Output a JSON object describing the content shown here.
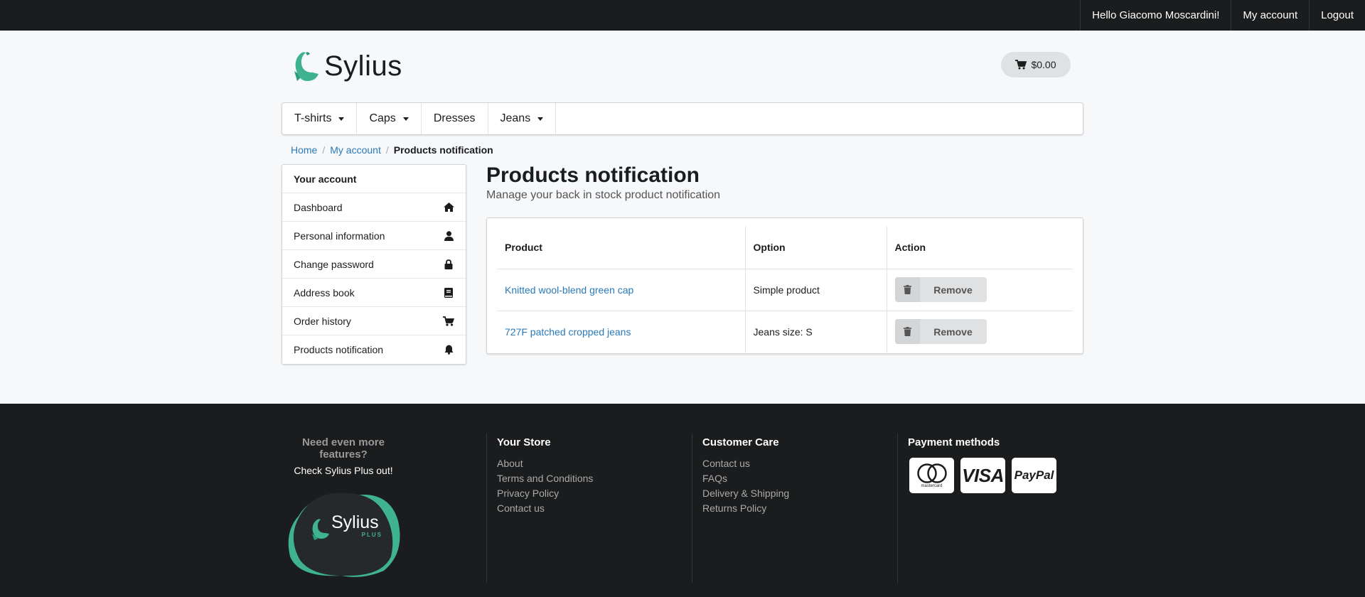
{
  "topbar": {
    "greeting": "Hello Giacomo Moscardini!",
    "account": "My account",
    "logout": "Logout"
  },
  "header": {
    "logo_text": "Sylius",
    "cart_total": "$0.00"
  },
  "menu": {
    "items": [
      {
        "label": "T-shirts",
        "dropdown": true
      },
      {
        "label": "Caps",
        "dropdown": true
      },
      {
        "label": "Dresses",
        "dropdown": false
      },
      {
        "label": "Jeans",
        "dropdown": true
      }
    ]
  },
  "breadcrumb": {
    "home": "Home",
    "account": "My account",
    "current": "Products notification"
  },
  "sidebar": {
    "title": "Your account",
    "items": [
      {
        "label": "Dashboard",
        "icon": "home-icon"
      },
      {
        "label": "Personal information",
        "icon": "user-icon"
      },
      {
        "label": "Change password",
        "icon": "lock-icon"
      },
      {
        "label": "Address book",
        "icon": "book-icon"
      },
      {
        "label": "Order history",
        "icon": "cart-icon"
      },
      {
        "label": "Products notification",
        "icon": "bell-icon"
      }
    ]
  },
  "main": {
    "title": "Products notification",
    "subtitle": "Manage your back in stock product notification",
    "table": {
      "headers": [
        "Product",
        "Option",
        "Action"
      ],
      "rows": [
        {
          "product": "Knitted wool-blend green cap",
          "option": "Simple product",
          "action": "Remove"
        },
        {
          "product": "727F patched cropped jeans",
          "option": "Jeans size: S",
          "action": "Remove"
        }
      ]
    }
  },
  "footer": {
    "promo_title": "Need even more features?",
    "promo_sub": "Check Sylius Plus out!",
    "plus_logo_text": "Sylius",
    "plus_logo_badge": "PLUS",
    "store": {
      "title": "Your Store",
      "links": [
        "About",
        "Terms and Conditions",
        "Privacy Policy",
        "Contact us"
      ]
    },
    "care": {
      "title": "Customer Care",
      "links": [
        "Contact us",
        "FAQs",
        "Delivery & Shipping",
        "Returns Policy"
      ]
    },
    "payment": {
      "title": "Payment methods",
      "methods": [
        "mastercard",
        "VISA",
        "PayPal"
      ]
    }
  },
  "colors": {
    "brand_green": "#3fb38e",
    "link_blue": "#2a7ab8",
    "dark": "#1b1c1d"
  }
}
